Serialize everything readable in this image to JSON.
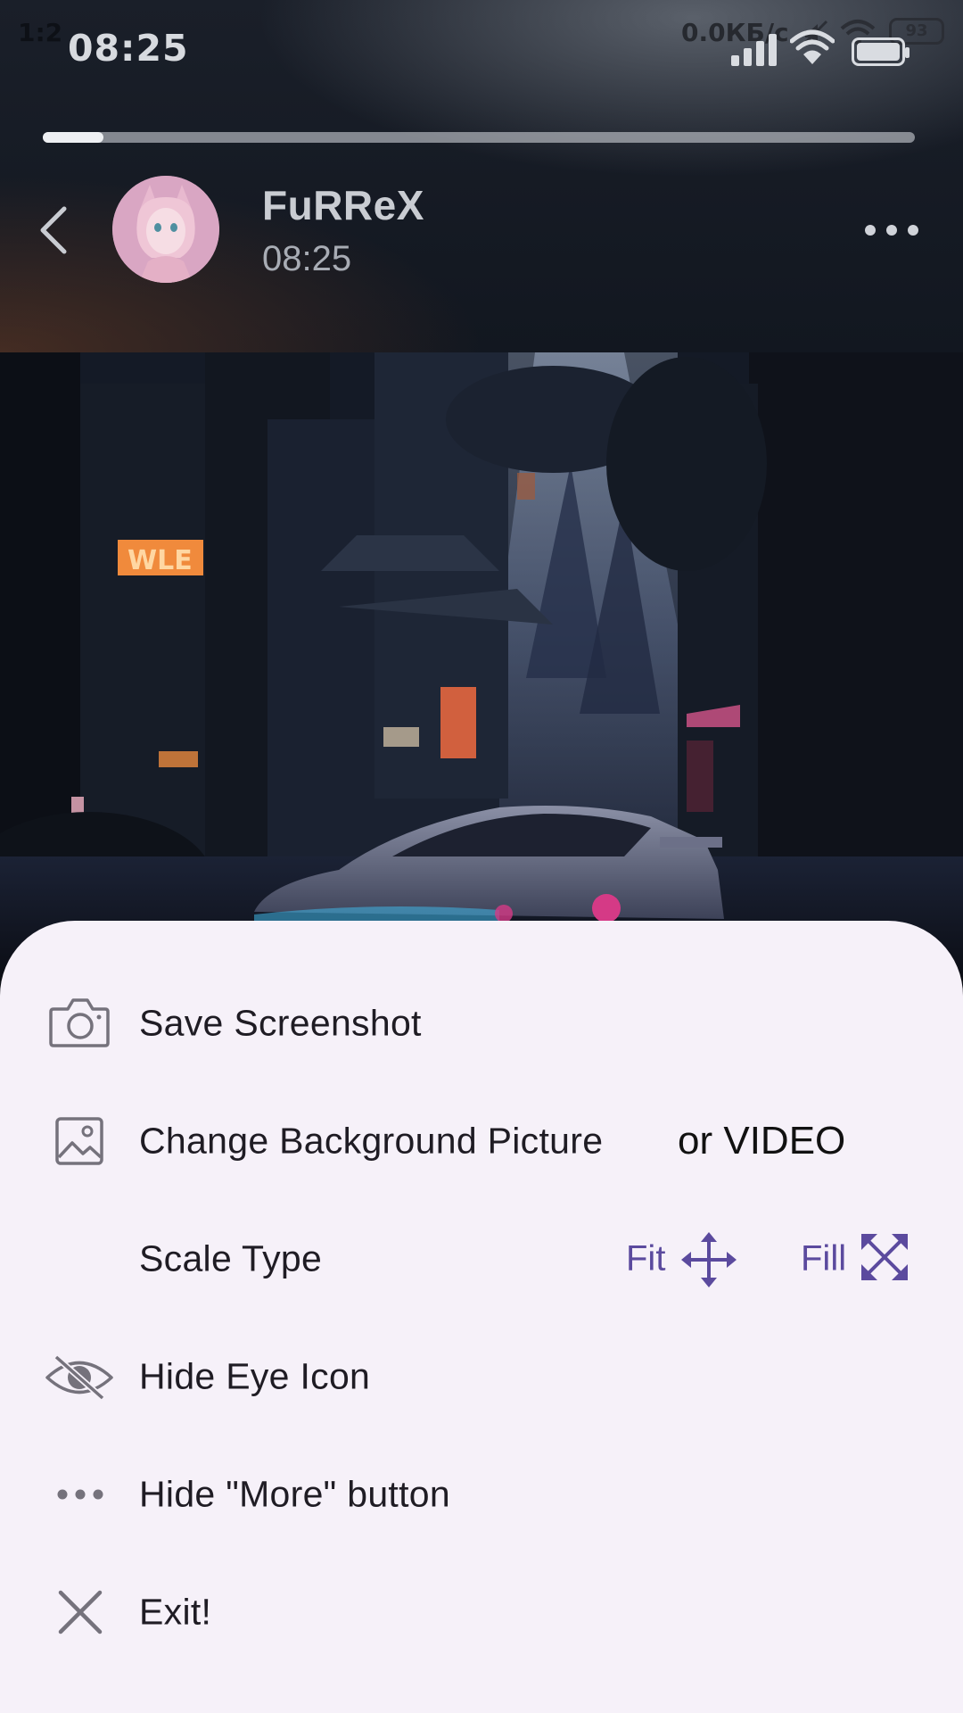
{
  "status_bar": {
    "time": "08:25",
    "ghost_time": "1:2",
    "net_speed": "0.0КБ/с",
    "battery": "93",
    "icons": [
      "signal-icon",
      "wifi-icon",
      "battery-icon",
      "silent-icon",
      "hotspot-icon"
    ]
  },
  "story": {
    "progress": 0.07,
    "user_name": "FuRReX",
    "time": "08:25"
  },
  "sheet": {
    "items": [
      {
        "label": "Save Screenshot",
        "icon": "camera-icon"
      },
      {
        "label": "Change Background Picture",
        "extra": "or VIDEO",
        "icon": "image-icon"
      },
      {
        "label": "Scale Type",
        "options": [
          {
            "label": "Fit",
            "icon": "move-arrows-icon"
          },
          {
            "label": "Fill",
            "icon": "expand-arrows-icon"
          }
        ]
      },
      {
        "label": "Hide Eye Icon",
        "icon": "eye-off-icon"
      },
      {
        "label": "Hide \"More\" button",
        "icon": "more-dots-icon"
      },
      {
        "label": "Exit!",
        "icon": "close-icon"
      }
    ]
  },
  "colors": {
    "sheet_bg": "#f6f1f9",
    "accent": "#5b4a9e",
    "icon_gray": "#75727c",
    "text_dark": "#1f1c24"
  }
}
